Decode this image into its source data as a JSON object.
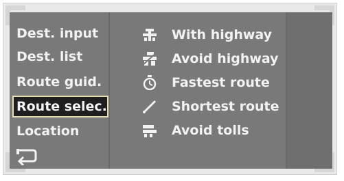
{
  "left_menu": {
    "items": [
      {
        "label": "Dest. input",
        "selected": false
      },
      {
        "label": "Dest. list",
        "selected": false
      },
      {
        "label": "Route guid.",
        "selected": false
      },
      {
        "label": "Route selec.",
        "selected": true
      },
      {
        "label": "Location",
        "selected": false
      }
    ],
    "back_icon": "return-arrow-icon"
  },
  "route_options": {
    "items": [
      {
        "label": "With highway",
        "icon": "highway-icon"
      },
      {
        "label": "Avoid highway",
        "icon": "avoid-highway-icon"
      },
      {
        "label": "Fastest route",
        "icon": "stopwatch-icon"
      },
      {
        "label": "Shortest route",
        "icon": "pencil-line-icon"
      },
      {
        "label": "Avoid tolls",
        "icon": "toll-gate-icon"
      }
    ]
  },
  "colors": {
    "screen_bg": "#797979",
    "text": "#f2f2f2",
    "selected_bg": "#1f1f1f",
    "selected_outline": "#e8e0b0"
  }
}
